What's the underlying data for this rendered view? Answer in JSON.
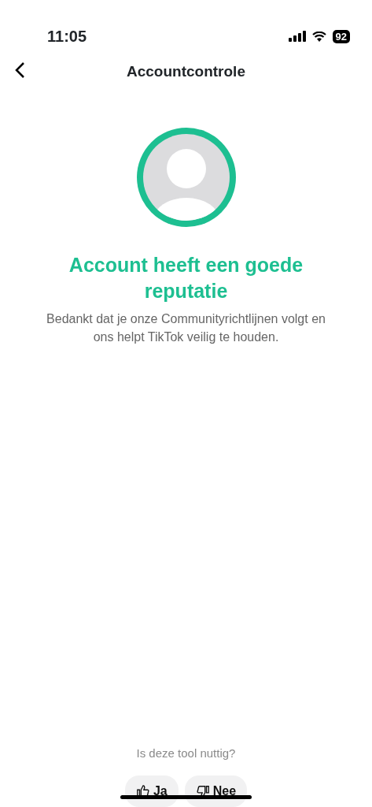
{
  "status_bar": {
    "time": "11:05",
    "battery": "92"
  },
  "header": {
    "title": "Accountcontrole"
  },
  "status": {
    "title": "Account heeft een goede reputatie",
    "message": "Bedankt dat je onze Communityrichtlijnen volgt en ons helpt TikTok veilig te houden."
  },
  "feedback": {
    "question": "Is deze tool nuttig?",
    "buttons": [
      {
        "kind": "up",
        "label": "Ja"
      },
      {
        "kind": "down",
        "label": "Nee"
      }
    ]
  }
}
